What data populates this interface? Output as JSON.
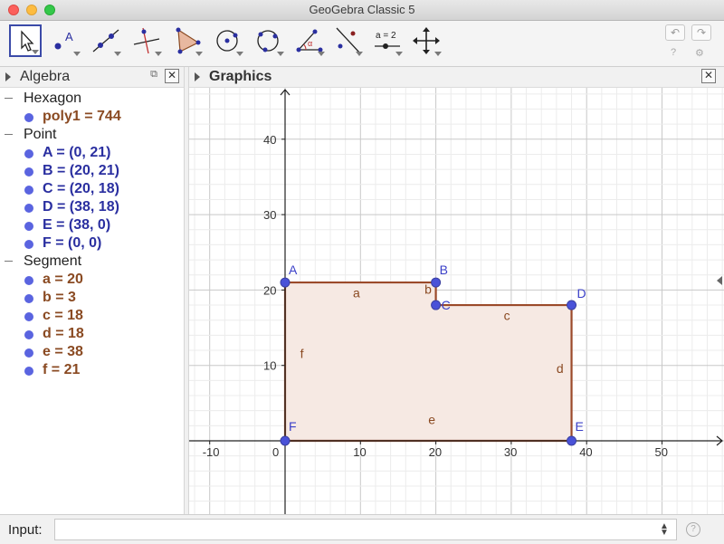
{
  "window": {
    "title": "GeoGebra Classic 5"
  },
  "toolbar": {
    "tools": [
      {
        "name": "move-tool",
        "selected": true
      },
      {
        "name": "point-tool"
      },
      {
        "name": "line-tool"
      },
      {
        "name": "perpendicular-line-tool"
      },
      {
        "name": "polygon-tool"
      },
      {
        "name": "circle-center-point-tool"
      },
      {
        "name": "circle-three-points-tool"
      },
      {
        "name": "angle-tool"
      },
      {
        "name": "reflect-tool"
      },
      {
        "name": "slider-tool",
        "label": "a = 2"
      },
      {
        "name": "move-graphics-view-tool"
      }
    ],
    "undo_icon": "undo-icon",
    "redo_icon": "redo-icon"
  },
  "algebra": {
    "title": "Algebra",
    "groups": [
      {
        "label": "Hexagon",
        "items": [
          {
            "text": "poly1 = 744",
            "kind": "poly"
          }
        ]
      },
      {
        "label": "Point",
        "items": [
          {
            "text": "A = (0, 21)",
            "kind": "point"
          },
          {
            "text": "B = (20, 21)",
            "kind": "point"
          },
          {
            "text": "C = (20, 18)",
            "kind": "point"
          },
          {
            "text": "D = (38, 18)",
            "kind": "point"
          },
          {
            "text": "E = (38, 0)",
            "kind": "point"
          },
          {
            "text": "F = (0, 0)",
            "kind": "point"
          }
        ]
      },
      {
        "label": "Segment",
        "items": [
          {
            "text": "a = 20",
            "kind": "poly"
          },
          {
            "text": "b = 3",
            "kind": "poly"
          },
          {
            "text": "c = 18",
            "kind": "poly"
          },
          {
            "text": "d = 18",
            "kind": "poly"
          },
          {
            "text": "e = 38",
            "kind": "poly"
          },
          {
            "text": "f = 21",
            "kind": "poly"
          }
        ]
      }
    ]
  },
  "graphics": {
    "title": "Graphics",
    "x_ticks": [
      "-10",
      "0",
      "10",
      "20",
      "30",
      "40",
      "50"
    ],
    "y_ticks": [
      "10",
      "20",
      "30",
      "40"
    ],
    "points": [
      {
        "label": "A",
        "x": 0,
        "y": 21
      },
      {
        "label": "B",
        "x": 20,
        "y": 21
      },
      {
        "label": "C",
        "x": 20,
        "y": 18
      },
      {
        "label": "D",
        "x": 38,
        "y": 18
      },
      {
        "label": "E",
        "x": 38,
        "y": 0
      },
      {
        "label": "F",
        "x": 0,
        "y": 0
      }
    ],
    "segment_labels": [
      "a",
      "b",
      "c",
      "d",
      "e",
      "f"
    ],
    "polygon_fill": "#f6e9e3",
    "polygon_stroke": "#9b4a2a",
    "point_color": "#4a52d8",
    "label_color": "#3b40c8"
  },
  "input": {
    "label": "Input:",
    "value": ""
  },
  "colors": {
    "poly_text": "#8a4a22",
    "point_text": "#2a2fa0"
  }
}
